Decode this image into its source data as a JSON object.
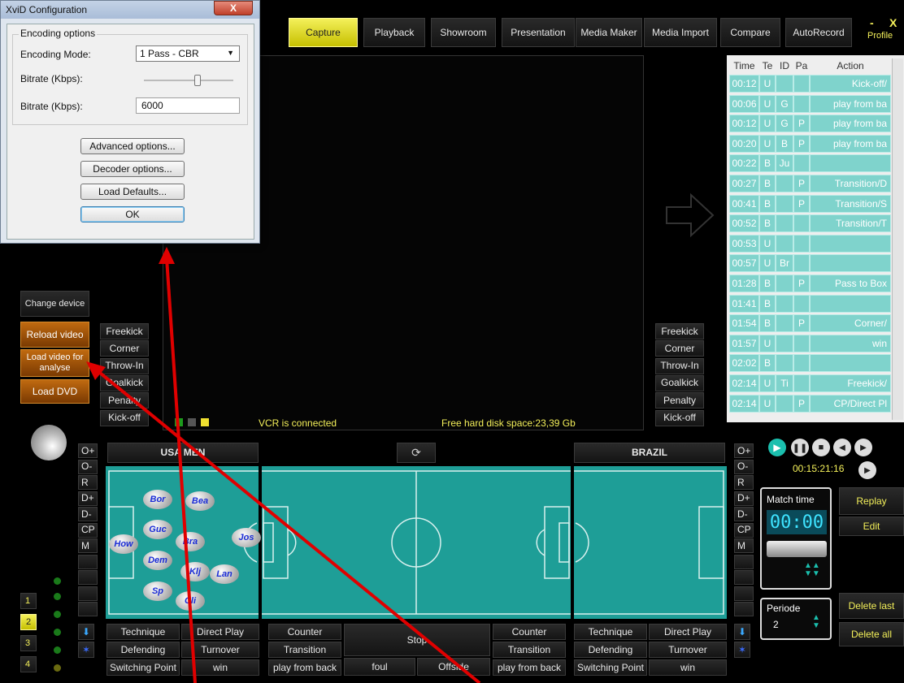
{
  "dialog": {
    "title": "XviD Configuration",
    "close": "X",
    "group": "Encoding options",
    "mode_label": "Encoding Mode:",
    "mode_value": "1 Pass - CBR",
    "bitrate_label1": "Bitrate (Kbps):",
    "bitrate_label2": "Bitrate (Kbps):",
    "bitrate_value": "6000",
    "advanced": "Advanced options...",
    "decoder": "Decoder options...",
    "defaults": "Load Defaults...",
    "ok": "OK"
  },
  "tabs": [
    "Capture",
    "Playback",
    "Showroom",
    "Presentation",
    "Media Maker",
    "Media Import",
    "Compare",
    "AutoRecord"
  ],
  "top_right": {
    "min": "-",
    "close": "X",
    "profile": "Profile"
  },
  "table": {
    "headers": [
      "Time",
      "Te",
      "ID",
      "Pa",
      "Action"
    ],
    "rows": [
      [
        "00:12",
        "U",
        "",
        "",
        "Kick-off/"
      ],
      [
        "00:06",
        "U",
        "G",
        "",
        "play from ba"
      ],
      [
        "00:12",
        "U",
        "G",
        "P",
        "play from ba"
      ],
      [
        "00:20",
        "U",
        "B",
        "P",
        "play from ba"
      ],
      [
        "00:22",
        "B",
        "Ju",
        "",
        ""
      ],
      [
        "00:27",
        "B",
        "",
        "P",
        "Transition/D"
      ],
      [
        "00:41",
        "B",
        "",
        "P",
        "Transition/S"
      ],
      [
        "00:52",
        "B",
        "",
        "",
        "Transition/T"
      ],
      [
        "00:53",
        "U",
        "",
        "",
        ""
      ],
      [
        "00:57",
        "U",
        "Br",
        "",
        ""
      ],
      [
        "01:28",
        "B",
        "",
        "P",
        "Pass to Box"
      ],
      [
        "01:41",
        "B",
        "",
        "",
        ""
      ],
      [
        "01:54",
        "B",
        "",
        "P",
        "Corner/"
      ],
      [
        "01:57",
        "U",
        "",
        "",
        "win"
      ],
      [
        "02:02",
        "B",
        "",
        "",
        ""
      ],
      [
        "02:14",
        "U",
        "Ti",
        "",
        "Freekick/"
      ],
      [
        "02:14",
        "U",
        "",
        "P",
        "CP/Direct Pl"
      ]
    ]
  },
  "left_buttons": {
    "change_device": "Change device",
    "reload_video": "Reload video",
    "load_video": "Load video for analyse",
    "load_dvd": "Load DVD"
  },
  "set_pieces_left": [
    "Freekick",
    "Corner",
    "Throw-In",
    "Goalkick",
    "Penalty",
    "Kick-off"
  ],
  "set_pieces_right": [
    "Freekick",
    "Corner",
    "Throw-In",
    "Goalkick",
    "Penalty",
    "Kick-off"
  ],
  "status": {
    "vcr": "VCR is connected",
    "disk": "Free hard disk space:23,39 Gb"
  },
  "teams": {
    "left": "USA MEN",
    "right": "BRAZIL"
  },
  "side_codes": [
    "O+",
    "O-",
    "R",
    "D+",
    "D-",
    "CP",
    "M"
  ],
  "players": [
    "Bor",
    "Bea",
    "Guc",
    "How",
    "Bra",
    "Jos",
    "Dem",
    "Klj",
    "Lan",
    "Sp",
    "Cli"
  ],
  "periods": [
    "1",
    "2",
    "3",
    "4"
  ],
  "playback": {
    "time": "00:15:21:16"
  },
  "match_time": {
    "label": "Match time",
    "value": "00:00"
  },
  "periode": {
    "label": "Periode",
    "value": "2"
  },
  "right_buttons": {
    "replay": "Replay",
    "edit": "Edit",
    "delete_last": "Delete last",
    "delete_all": "Delete all"
  },
  "bottom_left": {
    "row1": [
      "Technique",
      "Direct Play"
    ],
    "row2": [
      "Defending",
      "Turnover"
    ],
    "row3": [
      "Switching Point",
      "win"
    ]
  },
  "bottom_mid": {
    "counter_l": "Counter",
    "transition_l": "Transition",
    "playback_l": "play from back",
    "stop": "Stop",
    "foul": "foul",
    "offside": "Offside",
    "counter_r": "Counter",
    "transition_r": "Transition",
    "playback_r": "play from back"
  },
  "bottom_right": {
    "row1": [
      "Technique",
      "Direct Play"
    ],
    "row2": [
      "Defending",
      "Turnover"
    ],
    "row3": [
      "Switching Point",
      "win"
    ]
  },
  "colors": {
    "accent_yellow": "#f4f05a",
    "field": "#1e9e97",
    "table_cell": "#7fd3cc",
    "arrow": "#e00000"
  }
}
